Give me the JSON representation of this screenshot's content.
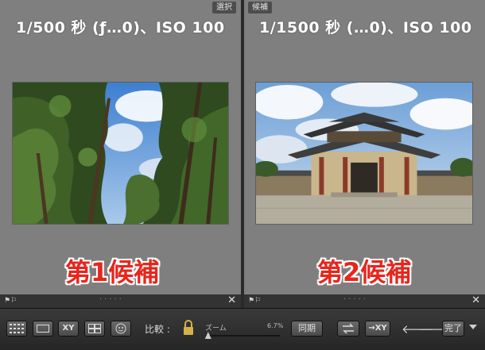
{
  "left_pane": {
    "tag": "選択",
    "info": "1/500 秒 (ƒ…0)、ISO 100",
    "label": "第1候補",
    "close": "✕"
  },
  "right_pane": {
    "tag": "候補",
    "info": "1/1500 秒 (…0)、ISO 100",
    "label": "第2候補",
    "close": "✕"
  },
  "toolbar": {
    "compare_label": "比較 :",
    "zoom_label": "ズーム",
    "zoom_value": "6.7%",
    "zoom_fraction": 0.03,
    "xy_label": "XY",
    "sync_label": "同期",
    "done_label": "完了",
    "close": "✕"
  },
  "colors": {
    "pane_bg": "#7f7f7f",
    "label_red": "#e8251c",
    "toolbar_bg": "#2e2e2e"
  }
}
